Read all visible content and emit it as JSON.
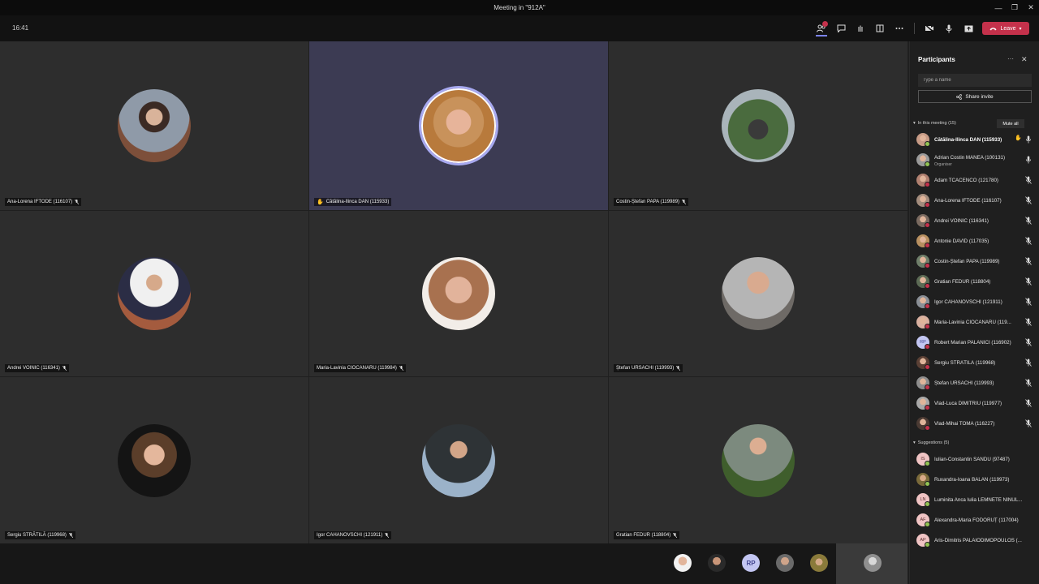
{
  "window": {
    "title": "Meeting in \"912A\"",
    "minimize": "—",
    "maximize": "❐",
    "close": "✕"
  },
  "toolbar": {
    "clock": "16:41",
    "leave_label": "Leave"
  },
  "tiles": [
    {
      "name": "Ana-Lorena IFTODE (116107)",
      "muted": true,
      "hand": false,
      "speaking": false
    },
    {
      "name": "Cătălina-Ilinca DAN (115933)",
      "muted": false,
      "hand": true,
      "speaking": true
    },
    {
      "name": "Costin-Ștefan PAPA (119989)",
      "muted": true,
      "hand": false,
      "speaking": false
    },
    {
      "name": "Andrei VOINIC (116341)",
      "muted": true,
      "hand": false,
      "speaking": false
    },
    {
      "name": "Maria-Lavinia CIOCANARU (119984)",
      "muted": true,
      "hand": false,
      "speaking": false
    },
    {
      "name": "Ștefan URSACHI (119993)",
      "muted": true,
      "hand": false,
      "speaking": false
    },
    {
      "name": "Sergiu STRĂTILĂ (119968)",
      "muted": true,
      "hand": false,
      "speaking": false
    },
    {
      "name": "Igor CAHANOVSCHI (121911)",
      "muted": true,
      "hand": false,
      "speaking": false
    },
    {
      "name": "Gratian FEDUR (118804)",
      "muted": true,
      "hand": false,
      "speaking": false
    }
  ],
  "strip": {
    "rp_initials": "RP"
  },
  "panel": {
    "title": "Participants",
    "more_label": "···",
    "search_placeholder": "Type a name",
    "share_label": "Share invite",
    "in_meeting_label": "In this meeting (15)",
    "mute_all_label": "Mute all",
    "suggestions_label": "Suggestions (5)",
    "participants": [
      {
        "name": "Cătălina-Ilinca DAN (115933)",
        "role": "",
        "hand": true
      },
      {
        "name": "Adrian Costin MANEA (100131)",
        "role": "Organiser",
        "hand": false
      },
      {
        "name": "Adam TCACENCO (121780)",
        "role": "",
        "hand": false
      },
      {
        "name": "Ana-Lorena IFTODE (116107)",
        "role": "",
        "hand": false
      },
      {
        "name": "Andrei VOINIC (116341)",
        "role": "",
        "hand": false
      },
      {
        "name": "Antonie DAVID (117035)",
        "role": "",
        "hand": false
      },
      {
        "name": "Costin-Ștefan PAPA (119989)",
        "role": "",
        "hand": false
      },
      {
        "name": "Gratian FEDUR (118804)",
        "role": "",
        "hand": false
      },
      {
        "name": "Igor CAHANOVSCHI (121911)",
        "role": "",
        "hand": false
      },
      {
        "name": "Maria-Lavinia CIOCANARU (119...",
        "role": "",
        "hand": false
      },
      {
        "name": "Robert Marian PALANICI (116902)",
        "role": "",
        "hand": false,
        "initials": "RP"
      },
      {
        "name": "Sergiu STRĂTILĂ (119968)",
        "role": "",
        "hand": false
      },
      {
        "name": "Ștefan URSACHI (119993)",
        "role": "",
        "hand": false
      },
      {
        "name": "Vlad-Luca DIMITRIU (119977)",
        "role": "",
        "hand": false
      },
      {
        "name": "Vlad-Mihai TOMA (116227)",
        "role": "",
        "hand": false
      }
    ],
    "suggestions": [
      {
        "name": "Iulian-Constantin SANDU (97487)",
        "initials": "IS"
      },
      {
        "name": "Ruxandra-Ioana BĂLAN (119973)",
        "initials": ""
      },
      {
        "name": "Luminita Anca Iulia LEMNETE NINUL...",
        "initials": "LN"
      },
      {
        "name": "Alexandra-Maria FODORUȚ (117004)",
        "initials": "AF"
      },
      {
        "name": "Aris-Dimitris PALAIODIMOPOULOS (...",
        "initials": "AP"
      }
    ]
  },
  "colors": {
    "accent": "#7b83eb",
    "leave": "#c4314b",
    "hand": "#f2b33d",
    "online": "#92c353"
  }
}
